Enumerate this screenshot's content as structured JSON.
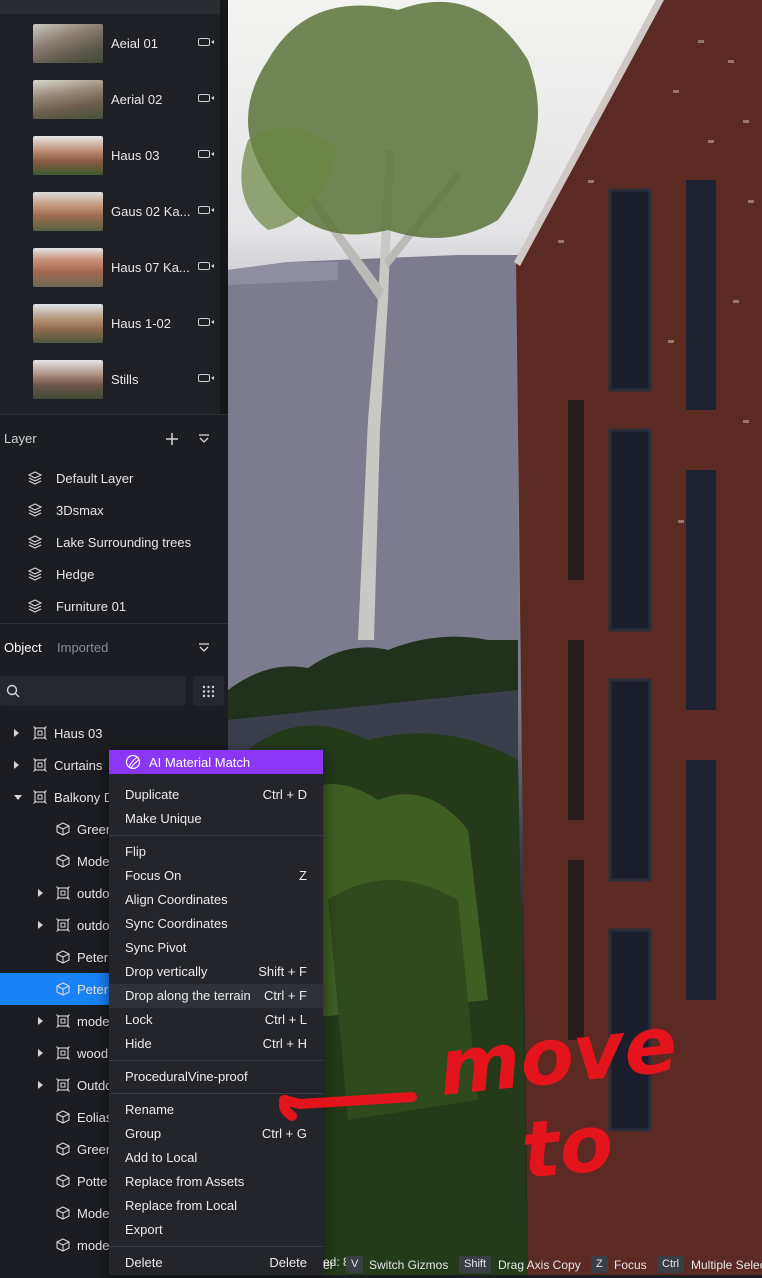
{
  "cameras": [
    {
      "label": "Aeial 01"
    },
    {
      "label": "Aerial 02"
    },
    {
      "label": "Haus 03"
    },
    {
      "label": "Gaus 02 Ka..."
    },
    {
      "label": "Haus 07 Ka..."
    },
    {
      "label": "Haus 1-02"
    },
    {
      "label": "Stills"
    }
  ],
  "layer_panel": {
    "title": "Layer",
    "items": [
      "Default Layer",
      "3Dsmax",
      "Lake Surrounding trees",
      "Hedge",
      "Furniture 01"
    ]
  },
  "object_panel": {
    "tabs": [
      "Object",
      "Imported"
    ],
    "search_placeholder": "",
    "tree": [
      {
        "label": "Haus 03",
        "type": "group",
        "expander": "collapsed"
      },
      {
        "label": "Curtains",
        "type": "group",
        "expander": "collapsed"
      },
      {
        "label": "Balkony D",
        "type": "group",
        "expander": "expanded"
      },
      {
        "label": "Green",
        "type": "object",
        "expander": "none"
      },
      {
        "label": "Mode",
        "type": "object",
        "expander": "none"
      },
      {
        "label": "outdo",
        "type": "group",
        "expander": "collapsed"
      },
      {
        "label": "outdo",
        "type": "group",
        "expander": "collapsed"
      },
      {
        "label": "Peter",
        "type": "object",
        "expander": "none"
      },
      {
        "label": "Peter",
        "type": "object",
        "expander": "none",
        "selected": true
      },
      {
        "label": "mode",
        "type": "group",
        "expander": "collapsed"
      },
      {
        "label": "wood",
        "type": "group",
        "expander": "collapsed"
      },
      {
        "label": "Outdo",
        "type": "group",
        "expander": "collapsed"
      },
      {
        "label": "Eolias",
        "type": "object",
        "expander": "none"
      },
      {
        "label": "Green",
        "type": "object",
        "expander": "none"
      },
      {
        "label": "Potte",
        "type": "object",
        "expander": "none"
      },
      {
        "label": "Mode",
        "type": "object",
        "expander": "none"
      },
      {
        "label": "mode",
        "type": "object",
        "expander": "none"
      }
    ]
  },
  "context_menu": {
    "ai_item": "AI Material Match",
    "groups": [
      [
        {
          "label": "Duplicate",
          "shortcut": "Ctrl + D"
        },
        {
          "label": "Make Unique",
          "shortcut": ""
        }
      ],
      [
        {
          "label": "Flip",
          "shortcut": ""
        },
        {
          "label": "Focus On",
          "shortcut": "Z"
        },
        {
          "label": "Align Coordinates",
          "shortcut": ""
        },
        {
          "label": "Sync Coordinates",
          "shortcut": ""
        },
        {
          "label": "Sync Pivot",
          "shortcut": ""
        },
        {
          "label": "Drop vertically",
          "shortcut": "Shift + F"
        },
        {
          "label": "Drop along the terrain",
          "shortcut": "Ctrl + F"
        },
        {
          "label": "Lock",
          "shortcut": "Ctrl + L"
        },
        {
          "label": "Hide",
          "shortcut": "Ctrl + H"
        }
      ],
      [
        {
          "label": "ProceduralVine-proof",
          "shortcut": ""
        }
      ],
      [
        {
          "label": "Rename",
          "shortcut": ""
        },
        {
          "label": "Group",
          "shortcut": "Ctrl + G"
        },
        {
          "label": "Add to Local",
          "shortcut": ""
        },
        {
          "label": "Replace from Assets",
          "shortcut": ""
        },
        {
          "label": "Replace from Local",
          "shortcut": ""
        },
        {
          "label": "Export",
          "shortcut": ""
        }
      ],
      [
        {
          "label": "Delete",
          "shortcut": "Delete"
        }
      ]
    ]
  },
  "status_bar": {
    "selected_fragment": "ed: 8",
    "tail_fragment": "er",
    "hints": [
      {
        "key": "V",
        "label": "Switch Gizmos"
      },
      {
        "key": "Shift",
        "label": "Drag Axis Copy"
      },
      {
        "key": "Z",
        "label": "Focus"
      },
      {
        "key": "Ctrl",
        "label": "Multiple Selec"
      }
    ]
  },
  "annotation": {
    "line1": "move",
    "line2": "to",
    "color": "#e3141b"
  },
  "colors": {
    "selection": "#1a82f7",
    "ai_item": "#8a37f5",
    "panel_bg": "#1b1d22"
  }
}
